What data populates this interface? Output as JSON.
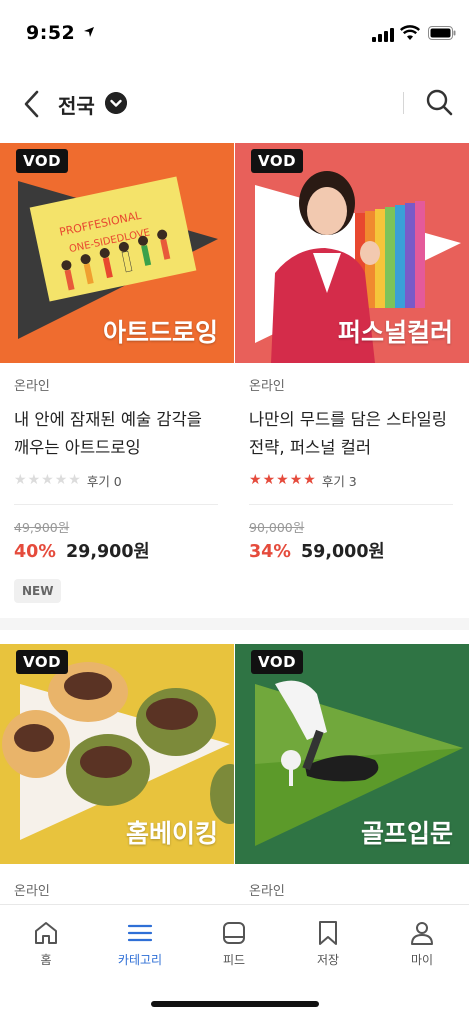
{
  "status": {
    "time": "9:52"
  },
  "header": {
    "region": "전국"
  },
  "products": [
    {
      "thumb_label": "VOD",
      "thumb_title": "아트드로잉",
      "thumb_bg": "#ef6c2f",
      "category": "온라인",
      "title_line1": "내 안에 잠재된 예술 감각을",
      "title_line2": "깨우는 아트드로잉",
      "rating_filled": 0,
      "review": "후기 0",
      "original_price": "49,900원",
      "discount": "40%",
      "price": "29,900원",
      "badge": "NEW"
    },
    {
      "thumb_label": "VOD",
      "thumb_title": "퍼스널컬러",
      "thumb_bg": "#e8605a",
      "category": "온라인",
      "title_line1": "나만의 무드를 담은 스타일링",
      "title_line2": "전략, 퍼스널 컬러",
      "rating_filled": 5,
      "review": "후기 3",
      "original_price": "90,000원",
      "discount": "34%",
      "price": "59,000원",
      "badge": ""
    },
    {
      "thumb_label": "VOD",
      "thumb_title": "홈베이킹",
      "thumb_bg": "#e8c33d",
      "category": "온라인"
    },
    {
      "thumb_label": "VOD",
      "thumb_title": "골프입문",
      "thumb_bg": "#2f7444",
      "category": "온라인"
    }
  ],
  "tabs": [
    {
      "label": "홈",
      "icon": "home-icon"
    },
    {
      "label": "카테고리",
      "icon": "menu-icon",
      "active": true
    },
    {
      "label": "피드",
      "icon": "feed-icon"
    },
    {
      "label": "저장",
      "icon": "bookmark-icon"
    },
    {
      "label": "마이",
      "icon": "person-icon"
    }
  ],
  "colors": {
    "accent": "#2f6fd6",
    "discount": "#e54b3c",
    "star": "#e54b3c"
  }
}
